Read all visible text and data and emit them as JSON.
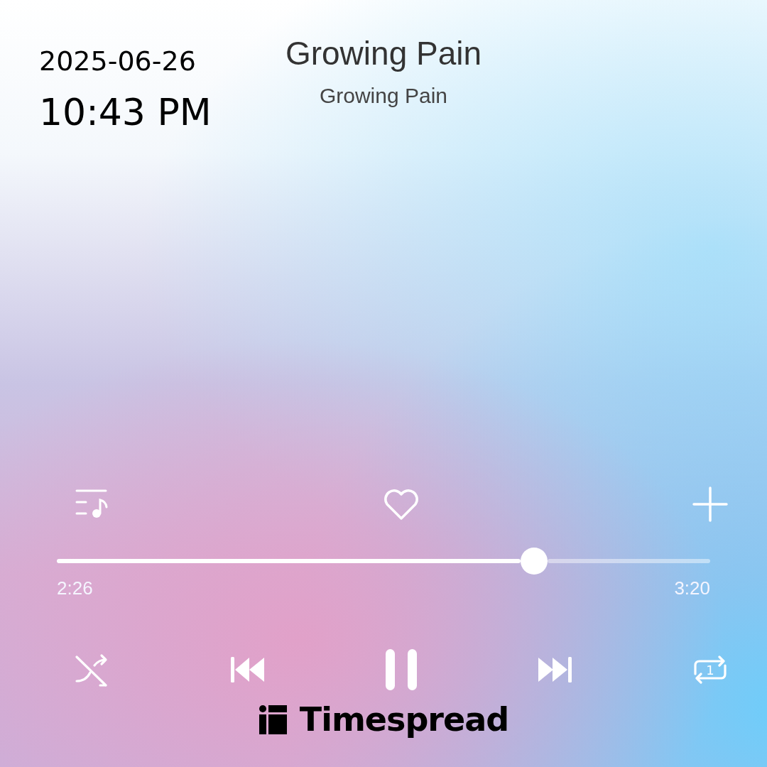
{
  "overlay": {
    "date": "2025-06-26",
    "time": "10:43 PM"
  },
  "track": {
    "title": "Growing Pain",
    "subtitle": "Growing Pain"
  },
  "actions": {
    "liked": false
  },
  "progress": {
    "level": 0.73,
    "elapsed": "2:26",
    "duration": "3:20"
  },
  "controls": {
    "playing": true,
    "repeat_one": true,
    "repeat_label": "1"
  },
  "brand": {
    "name": "Timespread"
  }
}
